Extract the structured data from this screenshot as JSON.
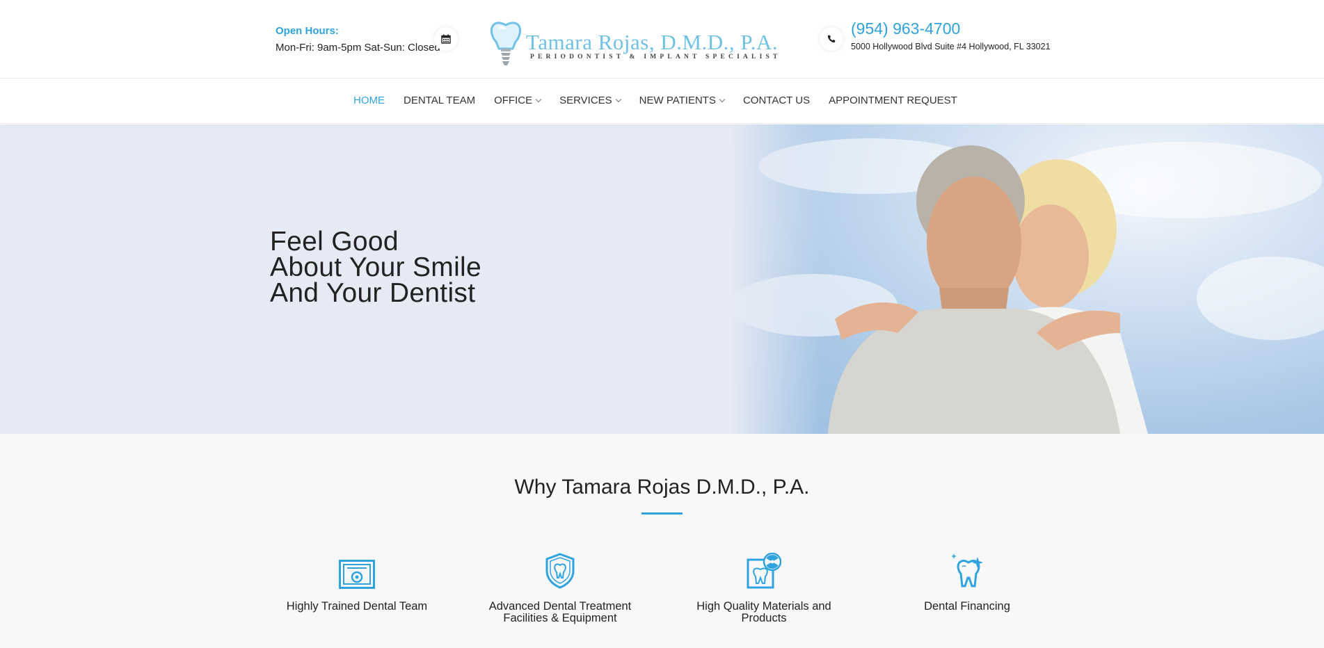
{
  "header": {
    "hours_label": "Open Hours:",
    "hours_value": "Mon-Fri: 9am-5pm Sat-Sun: Closed",
    "calendar_icon": "calendar-icon",
    "logo_wordmark": "Tamara Rojas, D.M.D., P.A.",
    "logo_tagline": "PERIODONTIST & IMPLANT SPECIALIST",
    "phone_icon": "phone-icon",
    "phone": "(954) 963-4700",
    "address": "5000 Hollywood Blvd Suite #4 Hollywood, FL 33021"
  },
  "nav": {
    "items": [
      {
        "label": "HOME",
        "active": true,
        "dropdown": false
      },
      {
        "label": "DENTAL TEAM",
        "active": false,
        "dropdown": false
      },
      {
        "label": "OFFICE",
        "active": false,
        "dropdown": true
      },
      {
        "label": "SERVICES",
        "active": false,
        "dropdown": true
      },
      {
        "label": "NEW PATIENTS",
        "active": false,
        "dropdown": true
      },
      {
        "label": "CONTACT US",
        "active": false,
        "dropdown": false
      },
      {
        "label": "APPOINTMENT REQUEST",
        "active": false,
        "dropdown": false
      }
    ]
  },
  "hero": {
    "line1": "Feel Good",
    "line2": "About Your Smile",
    "line3": "And Your Dentist"
  },
  "features": {
    "heading": "Why Tamara Rojas D.M.D., P.A.",
    "items": [
      {
        "label": "Highly Trained Dental Team",
        "icon": "certificate-icon"
      },
      {
        "label": "Advanced Dental Treatment Facilities & Equipment",
        "icon": "tooth-shield-icon"
      },
      {
        "label": "High Quality Materials and Products",
        "icon": "tooth-radiation-icon"
      },
      {
        "label": "Dental Financing",
        "icon": "sparkling-tooth-icon"
      }
    ]
  },
  "colors": {
    "accent": "#2fa3de",
    "logo": "#6fc1e6",
    "hero_bg": "#e6eaf4"
  }
}
